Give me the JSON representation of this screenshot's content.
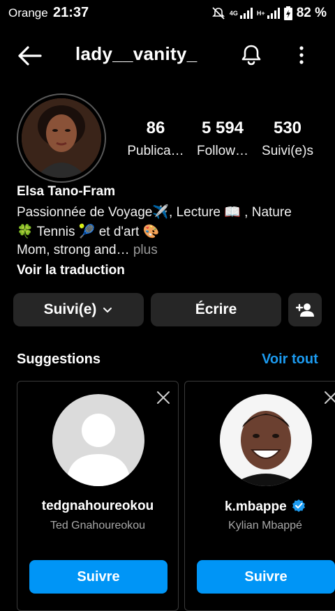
{
  "status_bar": {
    "carrier": "Orange",
    "time": "21:37",
    "network": "4G",
    "network2": "H+",
    "battery": "82 %"
  },
  "header": {
    "username": "lady__vanity_"
  },
  "stats": [
    {
      "value": "86",
      "label": "Publica…"
    },
    {
      "value": "5 594",
      "label": "Follow…"
    },
    {
      "value": "530",
      "label": "Suivi(e)s"
    }
  ],
  "profile": {
    "full_name": "Elsa Tano-Fram",
    "bio_line1": "Passionnée de Voyage✈️, Lecture 📖 , Nature",
    "bio_line2": "🍀 Tennis 🎾 et d'art 🎨",
    "bio_line3": "Mom, strong and…",
    "bio_more": " plus",
    "translate": "Voir la traduction"
  },
  "actions": {
    "following": "Suivi(e)",
    "message": "Écrire"
  },
  "suggestions": {
    "title": "Suggestions",
    "see_all": "Voir tout",
    "cards": [
      {
        "username": "tedgnahoureokou",
        "name": "Ted Gnahoureokou",
        "button": "Suivre"
      },
      {
        "username": "k.mbappe",
        "name": "Kylian Mbappé",
        "button": "Suivre"
      }
    ]
  },
  "colors": {
    "accent": "#0095f6",
    "link": "#1c9bf0",
    "button_bg": "#262626"
  }
}
